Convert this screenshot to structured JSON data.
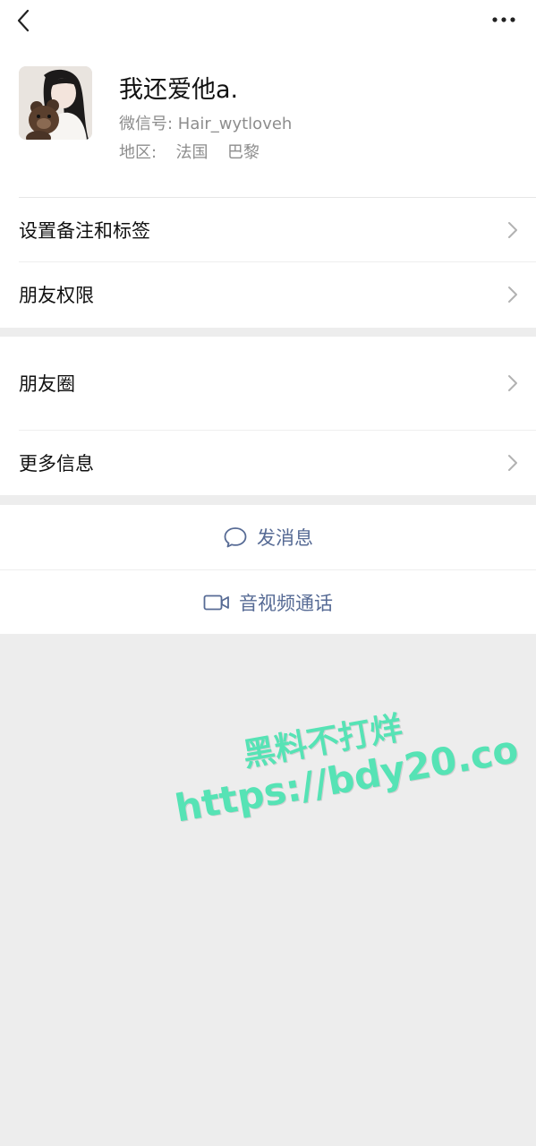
{
  "profile": {
    "name": "我还爱他a.",
    "wechat_id": "微信号:  Hair_wytloveh",
    "region_label": "地区:",
    "region_country": "法国",
    "region_city": "巴黎"
  },
  "menu": {
    "remarks_tags": "设置备注和标签",
    "friend_permissions": "朋友权限",
    "moments": "朋友圈",
    "more_info": "更多信息"
  },
  "actions": {
    "send_message": "发消息",
    "av_call": "音视频通话"
  },
  "watermark": {
    "line1": "黑料不打烊",
    "line2": "https://bdy20.co"
  },
  "colors": {
    "link": "#576b95",
    "background": "#ededed",
    "watermark": "#56e3b5"
  },
  "icons": {
    "back": "chevron-left-icon",
    "more": "more-dots-icon",
    "chevron": "chevron-right-icon",
    "message": "chat-bubble-icon",
    "video": "video-camera-icon"
  }
}
